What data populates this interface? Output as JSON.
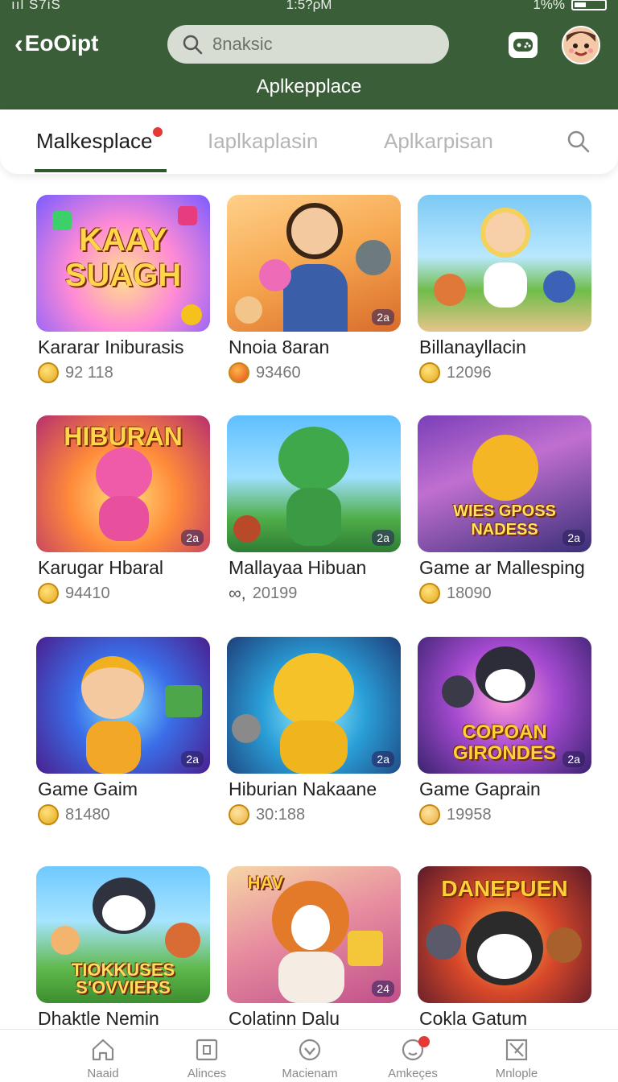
{
  "status_bar": {
    "signal": "ııl S7iS",
    "time": "1:5?ρM",
    "battery": "1%%"
  },
  "header": {
    "back_label": "EoOipt",
    "search_placeholder": "8naksic",
    "title": "Aplkepplace"
  },
  "tabs": [
    {
      "label": "Malkesplace",
      "active": true,
      "dot": true
    },
    {
      "label": "Iaplkaplasin",
      "active": false
    },
    {
      "label": "Aplkarpisan",
      "active": false
    }
  ],
  "cards": [
    {
      "name": "Kararar Iniburasis",
      "count": "92 118",
      "art_text": "KAAY SUAGH",
      "badge": ""
    },
    {
      "name": "Nnoia 8aran",
      "count": "93460",
      "art_text": "",
      "badge": "2a"
    },
    {
      "name": "Billanayllacin",
      "count": "12096",
      "art_text": "",
      "badge": ""
    },
    {
      "name": "Karugar Hbaral",
      "count": "94410",
      "art_text": "HIBURAN",
      "badge": "2a"
    },
    {
      "name": "Mallayaa Hibuan",
      "count": "20199",
      "art_text": "",
      "badge": "2a"
    },
    {
      "name": "Game ar Mallesping",
      "count": "18090",
      "art_text": "WIES GPOSS NADESS",
      "badge": "2a"
    },
    {
      "name": "Game Gaim",
      "count": "81480",
      "art_text": "",
      "badge": "2a"
    },
    {
      "name": "Hiburian Nakaane",
      "count": "30:188",
      "art_text": "",
      "badge": "2a"
    },
    {
      "name": "Game Gaprain",
      "count": "19958",
      "art_text": "COPOAN GIRONDES",
      "badge": "2a"
    },
    {
      "name": "Dhaktle Nemin",
      "count": "",
      "art_text": "TIOKKUSES S'OVVIERS",
      "badge": ""
    },
    {
      "name": "Colatinn Dalu",
      "count": "",
      "art_text": "HAV",
      "badge": "24"
    },
    {
      "name": "Cokla Gatum",
      "count": "",
      "art_text": "DANEPUEN",
      "badge": ""
    }
  ],
  "bottom_nav": [
    {
      "label": "Naaid"
    },
    {
      "label": "Alinces"
    },
    {
      "label": "Macienam"
    },
    {
      "label": "Amkeçes",
      "dot": true
    },
    {
      "label": "Mnlople"
    }
  ],
  "colors": {
    "header_green": "#3a5f38",
    "underline": "#2d5a30",
    "notification": "#e53935"
  }
}
